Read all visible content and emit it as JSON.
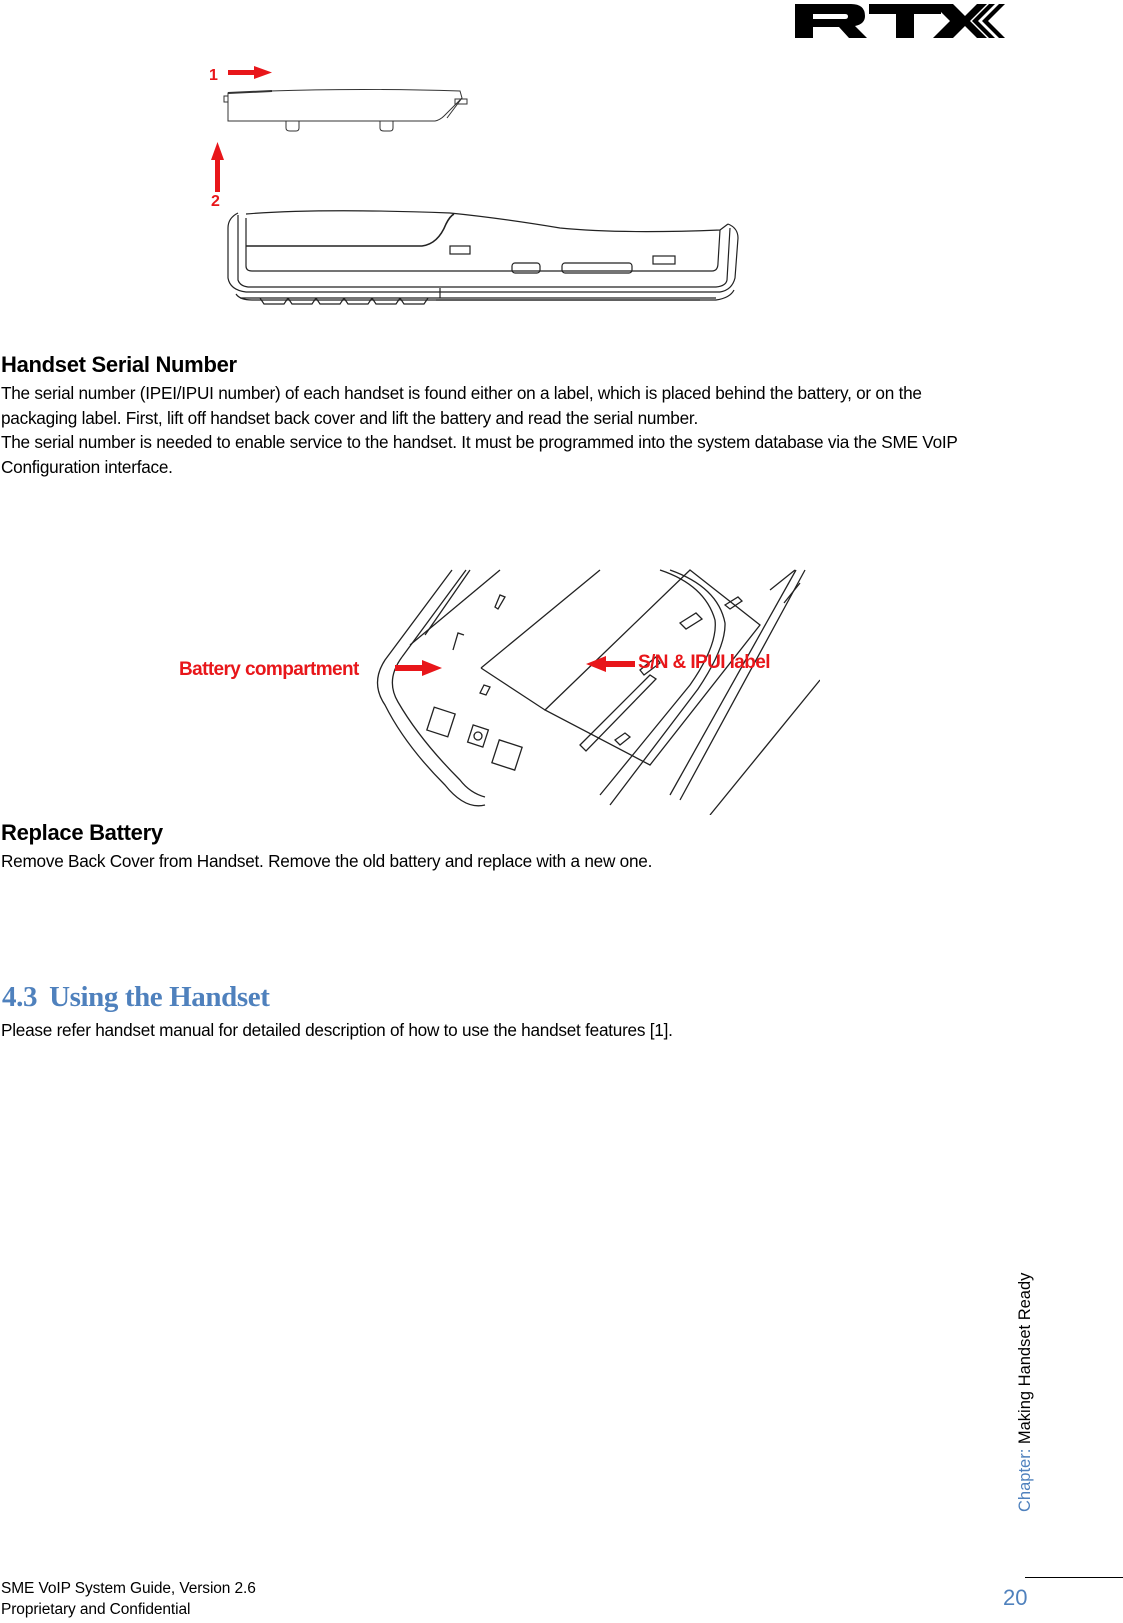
{
  "header": {
    "logo_text": "RTX"
  },
  "figure_cover_removal": {
    "step_1_label": "1",
    "step_2_label": "2",
    "arrow_color": "#e8161a"
  },
  "section_serial": {
    "heading": "Handset Serial Number",
    "paragraphs": [
      "The serial number (IPEI/IPUI number) of each handset is found either on a label, which is placed behind the battery, or on the packaging label. First, lift off handset back cover and lift the battery and read the serial number.",
      "The serial number is needed to enable service to the handset. It must be programmed into the system database via the SME VoIP Configuration interface."
    ]
  },
  "figure_battery": {
    "label_left": "Battery compartment",
    "label_right": "S/N & IPUI label",
    "label_color": "#e8161a"
  },
  "section_replace": {
    "heading": "Replace Battery",
    "paragraph": "Remove Back Cover from Handset. Remove the old battery and replace with a new one."
  },
  "section_43": {
    "number": "4.3",
    "title": "Using the Handset",
    "paragraph": "Please refer handset manual for detailed description of how to use the handset features [1]."
  },
  "sidebar": {
    "chapter_label": "Chapter:",
    "chapter_title": "Making Handset Ready"
  },
  "footer": {
    "line1": "SME VoIP System Guide, Version 2.6",
    "line2": "Proprietary and Confidential",
    "page_number": "20"
  },
  "colors": {
    "accent_blue": "#4f81bd",
    "annotation_red": "#e8161a"
  }
}
